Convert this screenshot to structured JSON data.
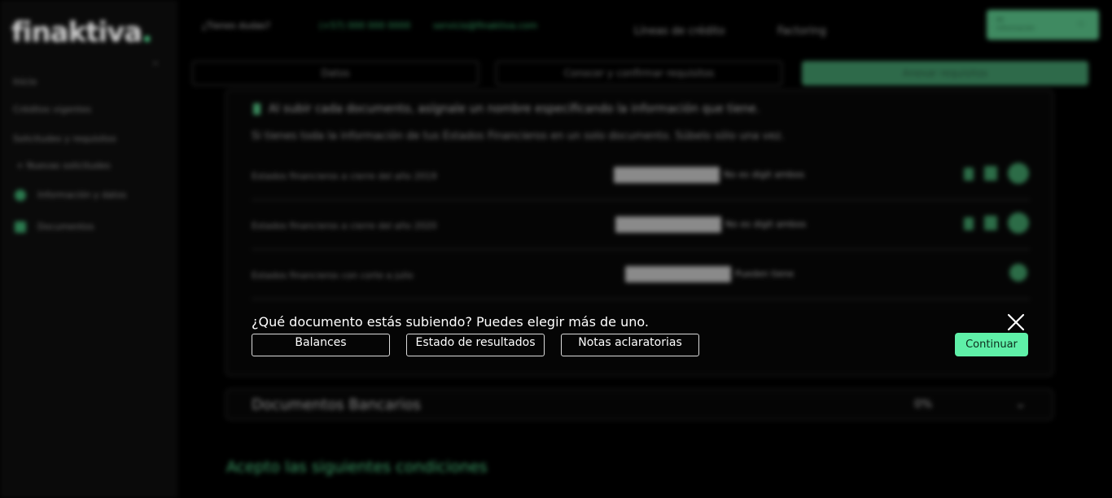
{
  "app": {
    "logo": "finaktiva",
    "logo_dot": ".",
    "collapse_icon": "chevron-up-icon"
  },
  "sidebar": {
    "items": [
      {
        "label": "Inicio"
      },
      {
        "label": "Créditos vigentes"
      },
      {
        "label": "Solicitudes y requisitos"
      },
      {
        "label": "Nuevas solicitudes"
      },
      {
        "label": "Información y datos",
        "icon": "info-icon"
      },
      {
        "label": "Documentos",
        "icon": "document-icon"
      }
    ]
  },
  "header": {
    "help": "¿Tienes dudas?",
    "phone": "(+57) 000 000 0000",
    "email": "servicio@finaktiva.com",
    "nav": [
      "Líneas de crédito",
      "Factoring"
    ],
    "user_line1": "Mi",
    "user_line2": "información"
  },
  "steps": [
    {
      "label": "Datos"
    },
    {
      "label": "Conocer y confirmar requisitos"
    },
    {
      "label": "Anexar requisitos"
    }
  ],
  "financial": {
    "tip": "Al subir cada documento, asígnale un nombre especificando la información que tiene.",
    "tip2": "Si tienes toda la información de tus Estados Financieros en un solo documento. Súbelo sólo una vez.",
    "rows": [
      {
        "name": "Estados financieros a cierre del año 2019",
        "status": "No es digit ambos"
      },
      {
        "name": "Estados financieros a cierre del año 2020",
        "status": "No es digit ambos"
      },
      {
        "name": "Estados financieros con corte a julio",
        "status": "Pueden tiene"
      }
    ]
  },
  "dialog": {
    "question": "¿Qué documento estás subiendo? Puedes elegir más de uno.",
    "options": [
      "Balances",
      "Estado de resultados",
      "Notas aclaratorias"
    ],
    "continue": "Continuar",
    "close_icon": "close-icon"
  },
  "bank": {
    "title": "Documentos Bancarios",
    "percent": "0%"
  },
  "accept_text": "Acepto las siguientes condiciones",
  "colors": {
    "accent": "#5ff0a8",
    "brand_dark": "#2e6a4a",
    "background": "#000000"
  }
}
